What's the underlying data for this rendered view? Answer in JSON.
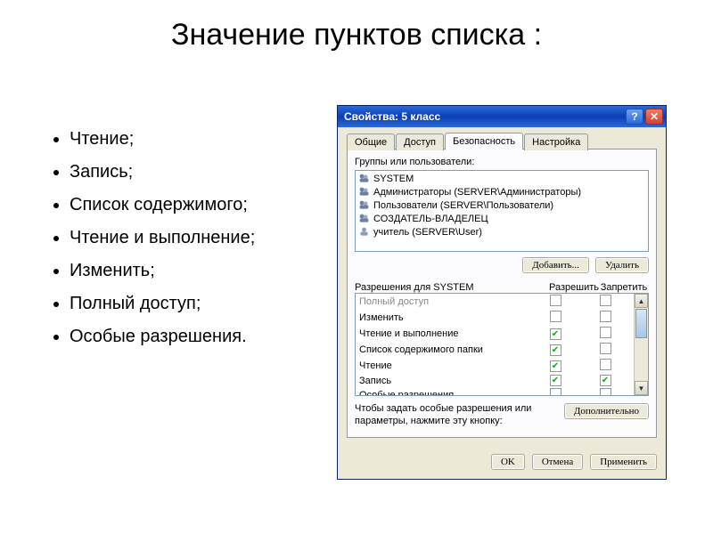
{
  "slide": {
    "title": "Значение пунктов списка :",
    "bullets": [
      "Чтение;",
      "Запись;",
      "Список содержимого;",
      "Чтение и выполнение;",
      "Изменить;",
      "Полный доступ;",
      "Особые разрешения."
    ]
  },
  "dialog": {
    "title": "Свойства: 5 класс",
    "help_symbol": "?",
    "close_symbol": "✕",
    "tabs": [
      "Общие",
      "Доступ",
      "Безопасность",
      "Настройка"
    ],
    "active_tab": "Безопасность",
    "groups_label": "Группы или пользователи:",
    "users": [
      "SYSTEM",
      "Администраторы (SERVER\\Администраторы)",
      "Пользователи (SERVER\\Пользователи)",
      "СОЗДАТЕЛЬ-ВЛАДЕЛЕЦ",
      "учитель (SERVER\\User)"
    ],
    "add_btn": "Добавить...",
    "remove_btn": "Удалить",
    "perm_header": {
      "name": "Разрешения для SYSTEM",
      "allow": "Разрешить",
      "deny": "Запретить"
    },
    "permissions": [
      {
        "name": "Полный доступ",
        "allow": false,
        "deny": false,
        "truncated": true
      },
      {
        "name": "Изменить",
        "allow": false,
        "deny": false
      },
      {
        "name": "Чтение и выполнение",
        "allow": true,
        "deny": false
      },
      {
        "name": "Список содержимого папки",
        "allow": true,
        "deny": false
      },
      {
        "name": "Чтение",
        "allow": true,
        "deny": false
      },
      {
        "name": "Запись",
        "allow": true,
        "deny": true
      },
      {
        "name": "Особые разрешения",
        "allow": false,
        "deny": false
      }
    ],
    "scroll_up": "▲",
    "scroll_down": "▼",
    "special_text": "Чтобы задать особые разрешения или параметры, нажмите эту кнопку:",
    "special_btn": "Дополнительно",
    "footer": {
      "ok": "OK",
      "cancel": "Отмена",
      "apply": "Применить"
    }
  }
}
